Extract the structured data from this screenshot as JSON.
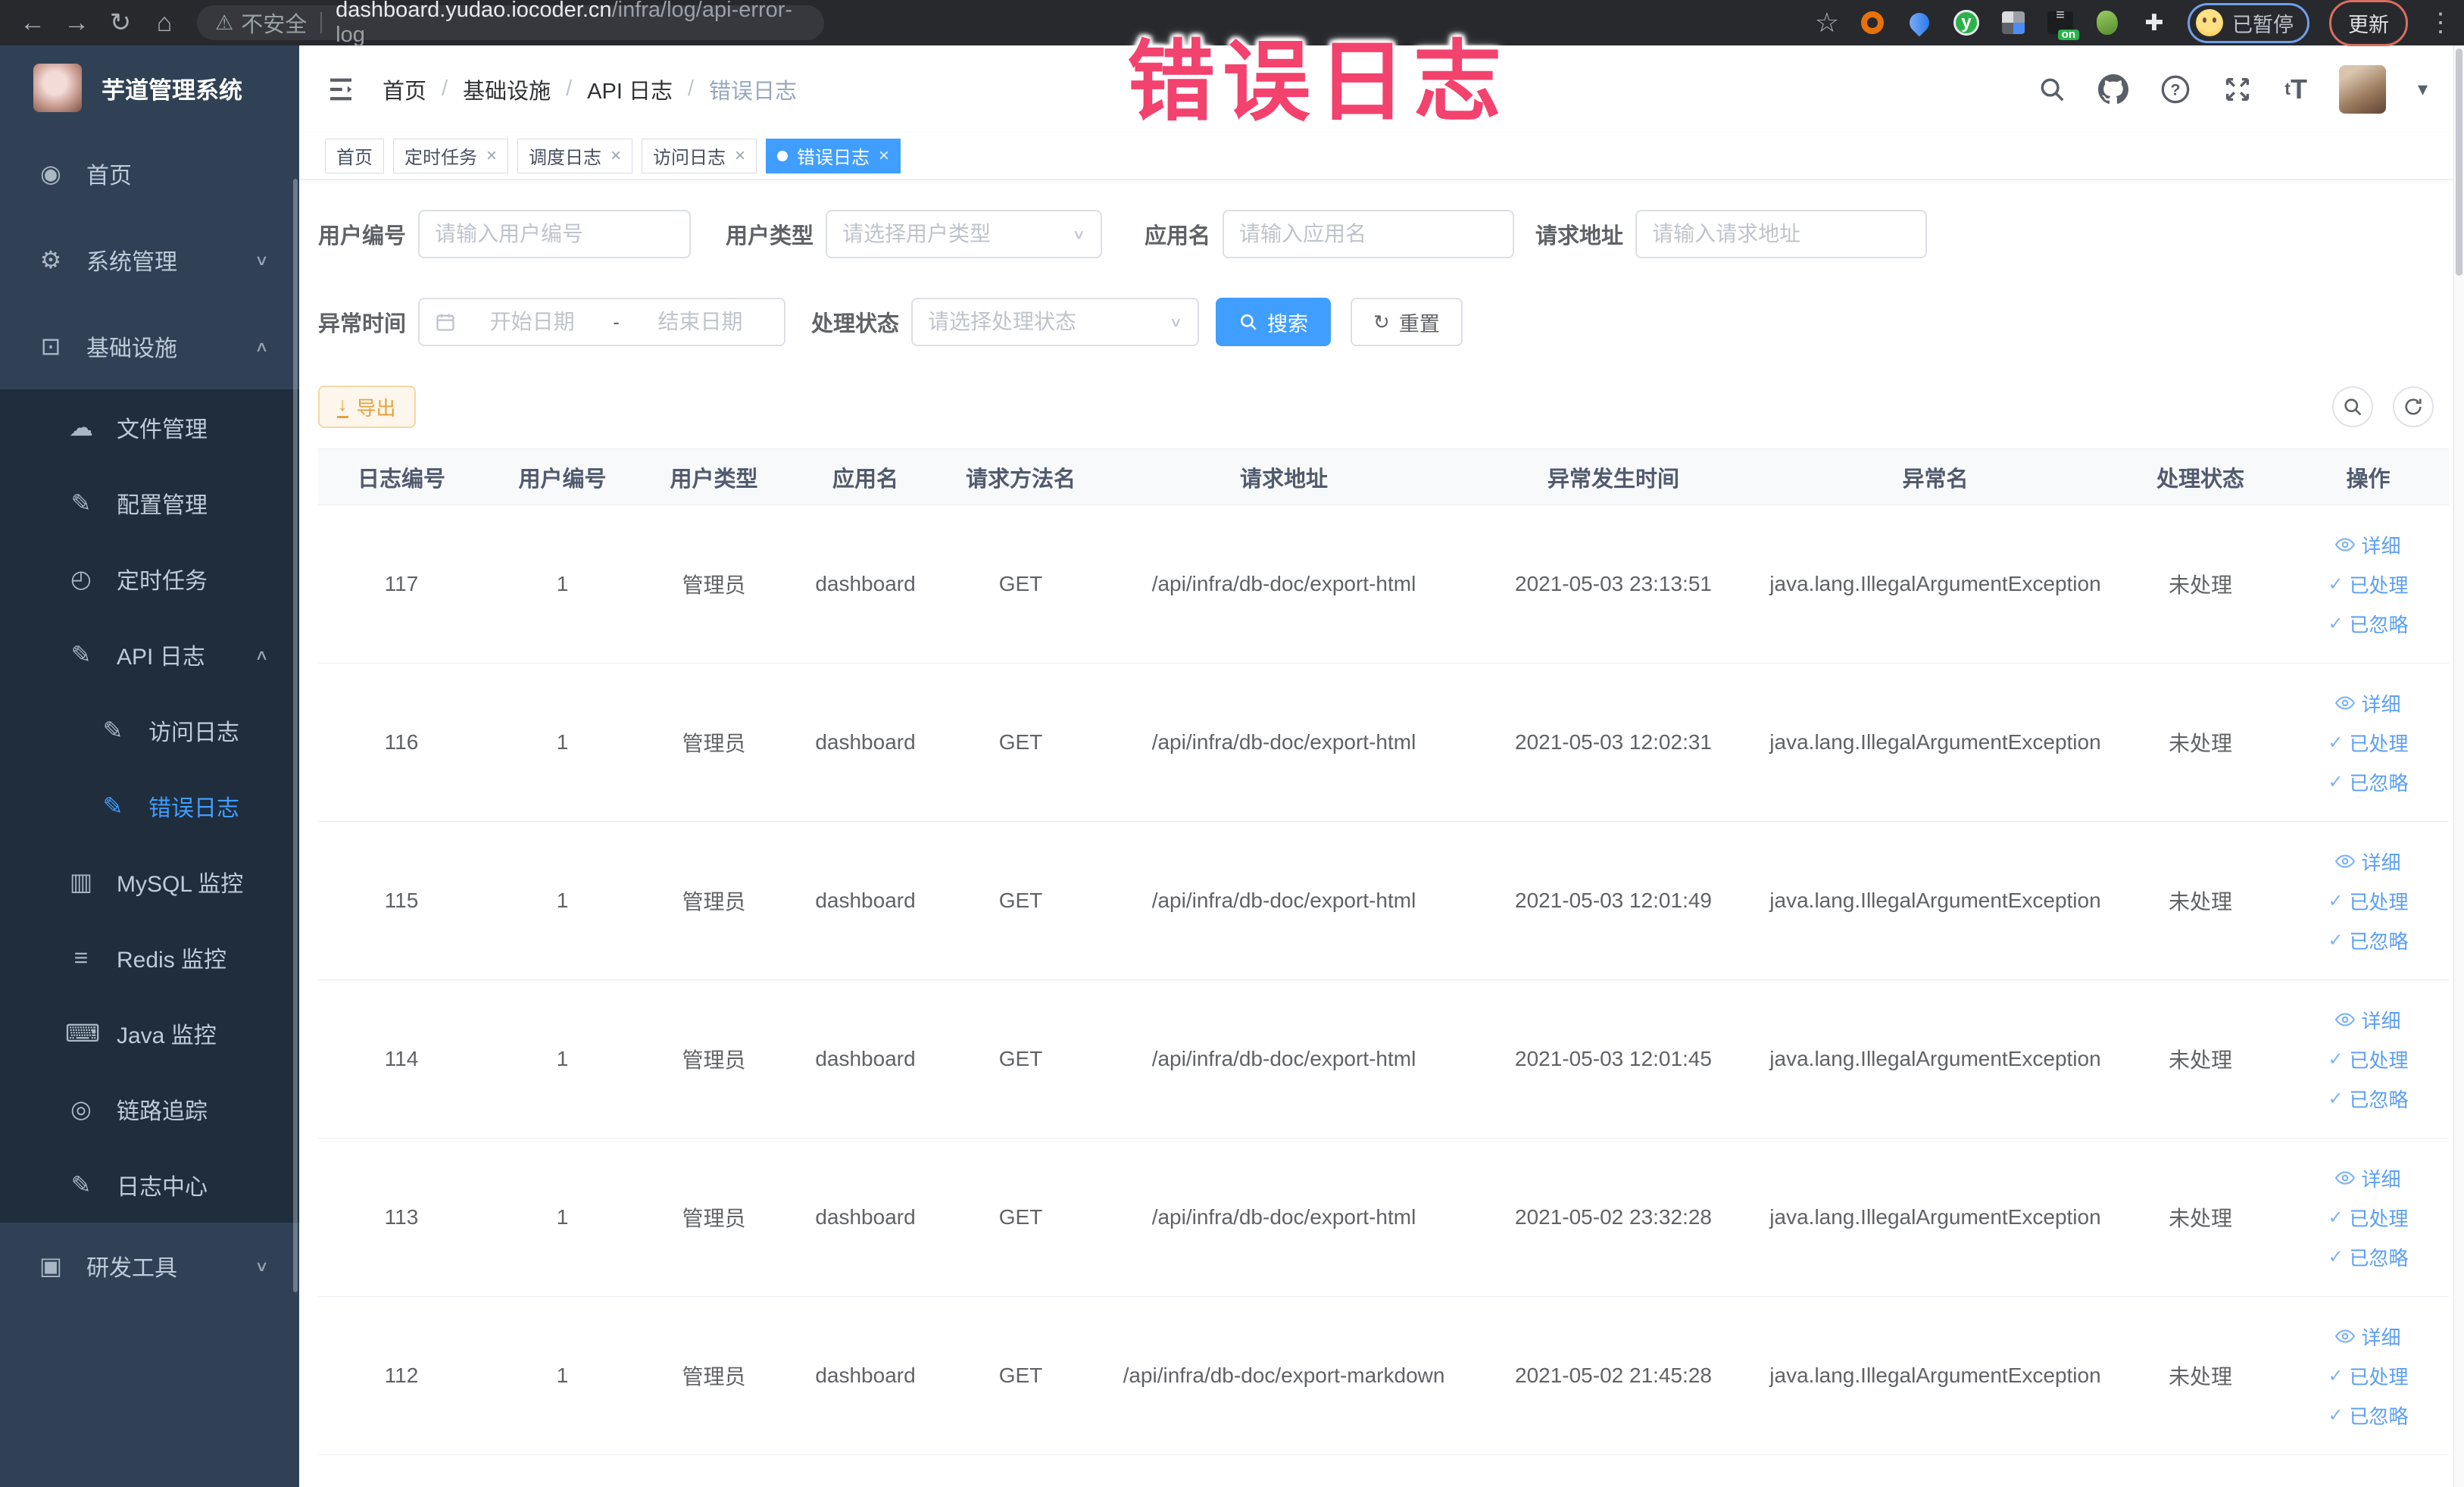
{
  "browser": {
    "security_label": "不安全",
    "url_host": "dashboard.yudao.iocoder.cn",
    "url_path": "/infra/log/api-error-log",
    "paused_label": "已暂停",
    "update_label": "更新"
  },
  "overlay": {
    "title": "错误日志"
  },
  "sidebar": {
    "logo_title": "芋道管理系统",
    "items": [
      {
        "name": "home",
        "label": "首页",
        "icon": "dashboard-icon",
        "glyph": "◉",
        "indent": 0,
        "dark": false,
        "active": false,
        "chevron": ""
      },
      {
        "name": "system",
        "label": "系统管理",
        "icon": "gear-icon",
        "glyph": "⚙",
        "indent": 0,
        "dark": false,
        "active": false,
        "chevron": "down"
      },
      {
        "name": "infrastructure",
        "label": "基础设施",
        "icon": "monitor-icon",
        "glyph": "⊡",
        "indent": 0,
        "dark": false,
        "active": false,
        "chevron": "up"
      },
      {
        "name": "file-management",
        "label": "文件管理",
        "icon": "cloud-upload-icon",
        "glyph": "☁",
        "indent": 1,
        "dark": true,
        "active": false,
        "chevron": ""
      },
      {
        "name": "config-management",
        "label": "配置管理",
        "icon": "edit-icon",
        "glyph": "✎",
        "indent": 1,
        "dark": true,
        "active": false,
        "chevron": ""
      },
      {
        "name": "scheduled-tasks",
        "label": "定时任务",
        "icon": "clock-icon",
        "glyph": "◴",
        "indent": 1,
        "dark": true,
        "active": false,
        "chevron": ""
      },
      {
        "name": "api-log",
        "label": "API 日志",
        "icon": "edit-square-icon",
        "glyph": "✎",
        "indent": 1,
        "dark": true,
        "active": false,
        "chevron": "up"
      },
      {
        "name": "access-log",
        "label": "访问日志",
        "icon": "edit-square-icon",
        "glyph": "✎",
        "indent": 2,
        "dark": true,
        "active": false,
        "chevron": ""
      },
      {
        "name": "error-log",
        "label": "错误日志",
        "icon": "edit-square-icon",
        "glyph": "✎",
        "indent": 2,
        "dark": true,
        "active": true,
        "chevron": ""
      },
      {
        "name": "mysql-monitor",
        "label": "MySQL 监控",
        "icon": "chart-icon",
        "glyph": "▥",
        "indent": 1,
        "dark": true,
        "active": false,
        "chevron": ""
      },
      {
        "name": "redis-monitor",
        "label": "Redis 监控",
        "icon": "stack-icon",
        "glyph": "≡",
        "indent": 1,
        "dark": true,
        "active": false,
        "chevron": ""
      },
      {
        "name": "java-monitor",
        "label": "Java 监控",
        "icon": "screen-icon",
        "glyph": "⌨",
        "indent": 1,
        "dark": true,
        "active": false,
        "chevron": ""
      },
      {
        "name": "trace",
        "label": "链路追踪",
        "icon": "eye-icon",
        "glyph": "◎",
        "indent": 1,
        "dark": true,
        "active": false,
        "chevron": ""
      },
      {
        "name": "log-center",
        "label": "日志中心",
        "icon": "edit-square-icon",
        "glyph": "✎",
        "indent": 1,
        "dark": true,
        "active": false,
        "chevron": ""
      },
      {
        "name": "dev-tools",
        "label": "研发工具",
        "icon": "briefcase-icon",
        "glyph": "▣",
        "indent": 0,
        "dark": false,
        "active": false,
        "chevron": "down"
      }
    ]
  },
  "header": {
    "breadcrumb": [
      "首页",
      "基础设施",
      "API 日志",
      "错误日志"
    ]
  },
  "tabs": [
    {
      "label": "首页",
      "closable": false,
      "active": false
    },
    {
      "label": "定时任务",
      "closable": true,
      "active": false
    },
    {
      "label": "调度日志",
      "closable": true,
      "active": false
    },
    {
      "label": "访问日志",
      "closable": true,
      "active": false
    },
    {
      "label": "错误日志",
      "closable": true,
      "active": true
    }
  ],
  "filters": {
    "user_id_label": "用户编号",
    "user_id_placeholder": "请输入用户编号",
    "user_type_label": "用户类型",
    "user_type_placeholder": "请选择用户类型",
    "app_name_label": "应用名",
    "app_name_placeholder": "请输入应用名",
    "request_url_label": "请求地址",
    "request_url_placeholder": "请输入请求地址",
    "exception_time_label": "异常时间",
    "start_date_placeholder": "开始日期",
    "date_separator": "-",
    "end_date_placeholder": "结束日期",
    "process_status_label": "处理状态",
    "process_status_placeholder": "请选择处理状态",
    "search_label": "搜索",
    "reset_label": "重置"
  },
  "toolbar": {
    "export_label": "导出"
  },
  "table": {
    "columns": [
      "日志编号",
      "用户编号",
      "用户类型",
      "应用名",
      "请求方法名",
      "请求地址",
      "异常发生时间",
      "异常名",
      "处理状态",
      "操作"
    ],
    "action_labels": [
      "详细",
      "已处理",
      "已忽略"
    ],
    "rows": [
      {
        "id": "117",
        "user_id": "1",
        "user_type": "管理员",
        "app_name": "dashboard",
        "method": "GET",
        "url": "/api/infra/db-doc/export-html",
        "time": "2021-05-03 23:13:51",
        "exception": "java.lang.IllegalArgumentException",
        "status": "未处理"
      },
      {
        "id": "116",
        "user_id": "1",
        "user_type": "管理员",
        "app_name": "dashboard",
        "method": "GET",
        "url": "/api/infra/db-doc/export-html",
        "time": "2021-05-03 12:02:31",
        "exception": "java.lang.IllegalArgumentException",
        "status": "未处理"
      },
      {
        "id": "115",
        "user_id": "1",
        "user_type": "管理员",
        "app_name": "dashboard",
        "method": "GET",
        "url": "/api/infra/db-doc/export-html",
        "time": "2021-05-03 12:01:49",
        "exception": "java.lang.IllegalArgumentException",
        "status": "未处理"
      },
      {
        "id": "114",
        "user_id": "1",
        "user_type": "管理员",
        "app_name": "dashboard",
        "method": "GET",
        "url": "/api/infra/db-doc/export-html",
        "time": "2021-05-03 12:01:45",
        "exception": "java.lang.IllegalArgumentException",
        "status": "未处理"
      },
      {
        "id": "113",
        "user_id": "1",
        "user_type": "管理员",
        "app_name": "dashboard",
        "method": "GET",
        "url": "/api/infra/db-doc/export-html",
        "time": "2021-05-02 23:32:28",
        "exception": "java.lang.IllegalArgumentException",
        "status": "未处理"
      },
      {
        "id": "112",
        "user_id": "1",
        "user_type": "管理员",
        "app_name": "dashboard",
        "method": "GET",
        "url": "/api/infra/db-doc/export-markdown",
        "time": "2021-05-02 21:45:28",
        "exception": "java.lang.IllegalArgumentException",
        "status": "未处理"
      }
    ]
  },
  "colors": {
    "primary": "#409eff",
    "annotation_pink": "#f3426d",
    "warning": "#e6a23c",
    "sidebar_bg": "#304156",
    "sidebar_dark_bg": "#1f2d3d"
  }
}
